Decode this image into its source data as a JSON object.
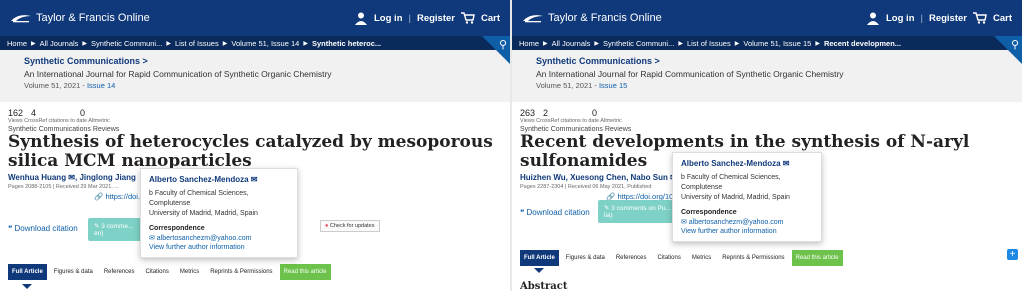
{
  "brand": "Taylor & Francis Online",
  "account": {
    "login": "Log in",
    "divider": "|",
    "register": "Register",
    "cart": "Cart"
  },
  "left": {
    "crumbs": [
      "Home",
      "All Journals",
      "Synthetic Communi...",
      "List of Issues",
      "Volume 51, Issue 14",
      "Synthetic heteroc..."
    ],
    "journal_title": "Synthetic Communications >",
    "journal_subtitle": "An International Journal for Rapid Communication of Synthetic Organic Chemistry",
    "volume": "Volume 51, 2021 - ",
    "issue": "Issue 14",
    "views": "162",
    "crossref": "4",
    "altmetric": "0",
    "metrics_label": "Views CrossRef citations to date Altmetric",
    "section": "Synthetic Communications Reviews",
    "title": "Synthesis of heterocycles catalyzed by mesoporous silica MCM nanoparticles",
    "authors": "Wenhua Huang ✉, Jinglong Jiang",
    "pages": "Pages 2088-2105 | Received 29 Mar 2021, ...",
    "doi": "https://doi...",
    "download": "Download citation",
    "comment": "3 comme... en)",
    "check": "Check for updates",
    "popover": {
      "name": "Alberto Sanchez-Mendoza ✉",
      "affil1": "b Faculty of Chemical Sciences, Complutense",
      "affil2": "University of Madrid, Madrid, Spain",
      "corr": "Correspondence",
      "email": "✉ albertosanchezm@yahoo.com",
      "further": "View further author information"
    },
    "tabs": [
      "Full Article",
      "Figures & data",
      "References",
      "Citations",
      "Metrics",
      "Reprints & Permissions",
      "Read this article"
    ]
  },
  "right": {
    "crumbs": [
      "Home",
      "All Journals",
      "Synthetic Communi...",
      "List of Issues",
      "Volume 51, Issue 15",
      "Recent developmen..."
    ],
    "journal_title": "Synthetic Communications >",
    "journal_subtitle": "An International Journal for Rapid Communication of Synthetic Organic Chemistry",
    "volume": "Volume 51, 2021 - ",
    "issue": "Issue 15",
    "views": "263",
    "crossref": "2",
    "altmetric": "0",
    "metrics_label": "Views CrossRef citations to date Altmetric",
    "section": "Synthetic Communications Reviews",
    "title": "Recent developments in the synthesis of N-aryl sulfonamides",
    "authors": "Huizhen Wu, Xuesong Chen, Nabo Sun ✉",
    "pages": "Pages 2287-2304 | Received 06 May 2021, Published",
    "doi": "https://doi.org/10.10",
    "download": "Download citation",
    "comment": "3 comments on Pu... lia)",
    "popover": {
      "name": "Alberto Sanchez-Mendoza ✉",
      "affil1": "b Faculty of Chemical Sciences, Complutense",
      "affil2": "University of Madrid, Madrid, Spain",
      "corr": "Correspondence",
      "email": "✉ albertosanchezm@yahoo.com",
      "further": "View further author information"
    },
    "tabs": [
      "Full Article",
      "Figures & data",
      "References",
      "Citations",
      "Metrics",
      "Reprints & Permissions",
      "Read this article"
    ],
    "abstract": "Abstract"
  }
}
